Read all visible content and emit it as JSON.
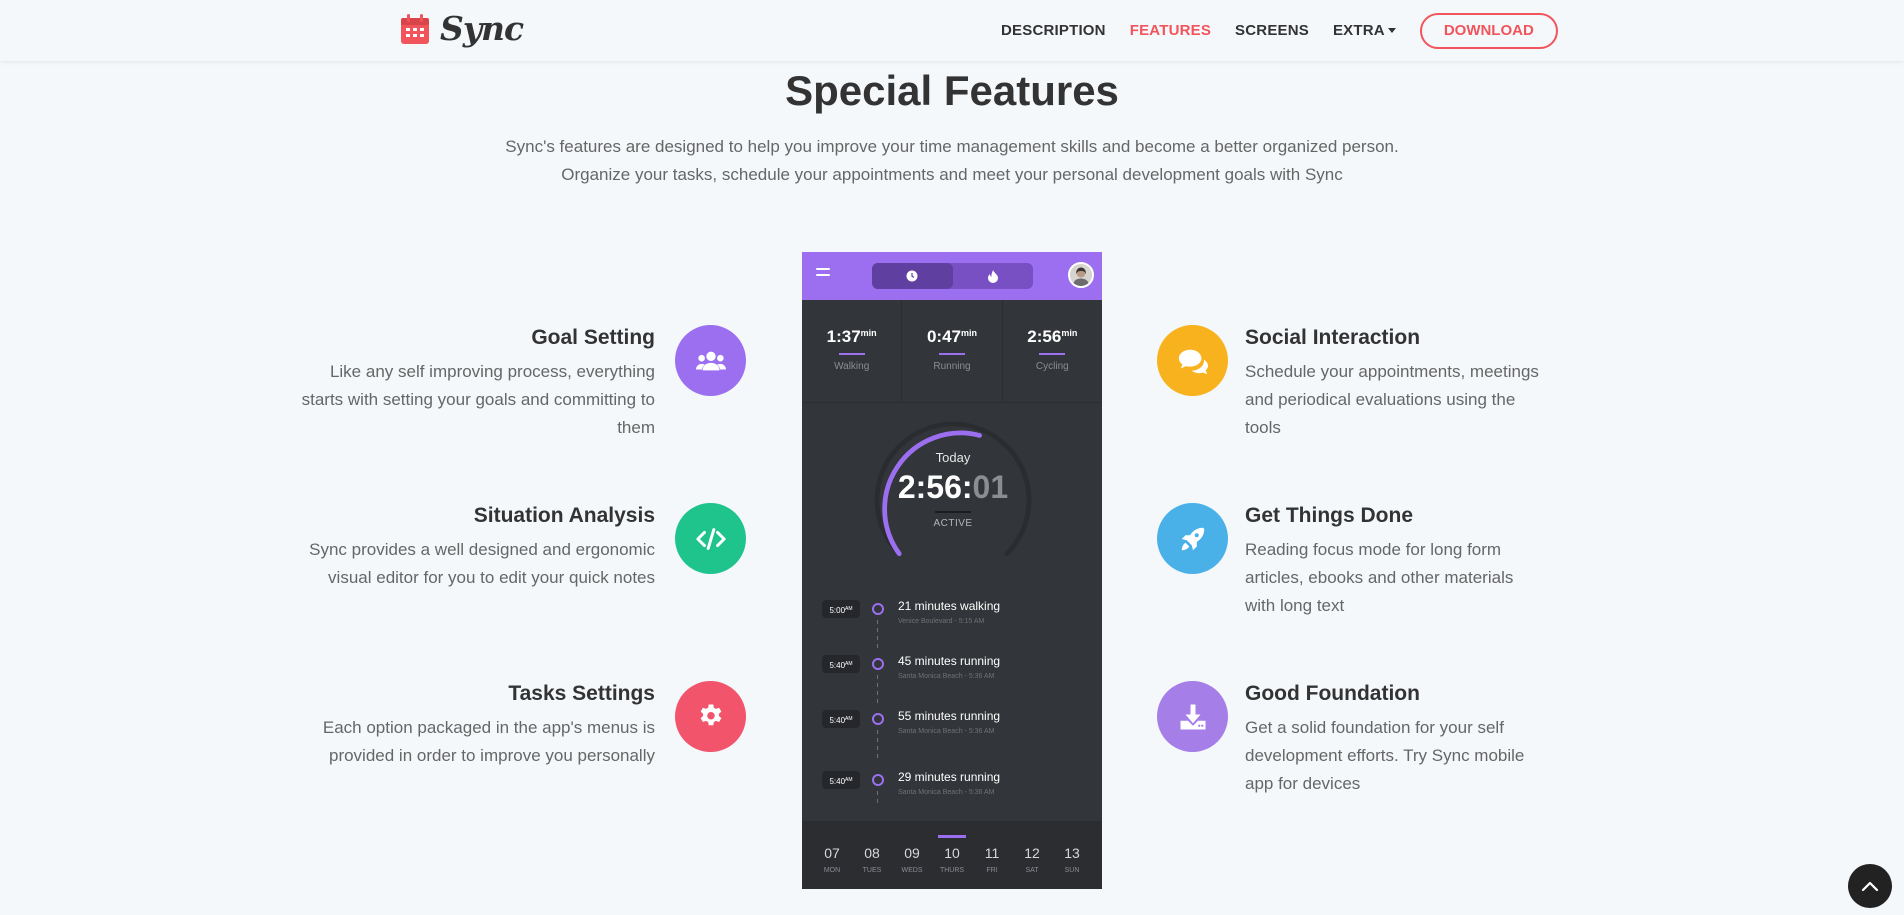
{
  "brand": {
    "name": "Sync",
    "icon": "calendar-icon",
    "color": "#f2545b"
  },
  "nav": {
    "items": [
      {
        "label": "DESCRIPTION",
        "active": false
      },
      {
        "label": "FEATURES",
        "active": true
      },
      {
        "label": "SCREENS",
        "active": false
      },
      {
        "label": "EXTRA",
        "active": false,
        "dropdown": true
      }
    ],
    "download_label": "DOWNLOAD"
  },
  "section": {
    "title": "Special Features",
    "lead_line1": "Sync's features are designed to help you improve your time management skills and become a better organized person.",
    "lead_line2": "Organize your tasks, schedule your appointments and meet your personal development goals with Sync"
  },
  "features_left": [
    {
      "title": "Goal Setting",
      "text": "Like any self improving process, everything starts with setting your goals and committing to them",
      "icon": "users-icon",
      "color": "#9c6ff0"
    },
    {
      "title": "Situation Analysis",
      "text": "Sync provides a well designed and ergonomic visual editor for you to edit your quick notes",
      "icon": "code-icon",
      "color": "#1fc48d"
    },
    {
      "title": "Tasks Settings",
      "text": "Each option packaged in the app's menus is provided in order to improve you personally",
      "icon": "gear-icon",
      "color": "#f2546b"
    }
  ],
  "features_right": [
    {
      "title": "Social Interaction",
      "text": "Schedule your appointments, meetings and periodical evaluations using the tools",
      "icon": "comments-icon",
      "color": "#f8b21d"
    },
    {
      "title": "Get Things Done",
      "text": "Reading focus mode for long form articles, ebooks and other materials with long text",
      "icon": "rocket-icon",
      "color": "#4ab0e8"
    },
    {
      "title": "Good Foundation",
      "text": "Get a solid foundation for your self development efforts. Try Sync mobile app for devices",
      "icon": "download-icon",
      "color": "#a57ee8"
    }
  ],
  "phone": {
    "stats": [
      {
        "value": "1:37",
        "unit": "min",
        "label": "Walking"
      },
      {
        "value": "0:47",
        "unit": "min",
        "label": "Running"
      },
      {
        "value": "2:56",
        "unit": "min",
        "label": "Cycling"
      }
    ],
    "ring": {
      "label": "Today",
      "time_main": "2:56:",
      "time_sec": "01",
      "status": "ACTIVE"
    },
    "timeline": [
      {
        "time": "5:00",
        "ampm": "AM",
        "title": "21 minutes walking",
        "sub": "Venice Boulevard - 5:15 AM"
      },
      {
        "time": "5:40",
        "ampm": "AM",
        "title": "45 minutes running",
        "sub": "Santa Monica Beach - 5:36 AM"
      },
      {
        "time": "5:40",
        "ampm": "AM",
        "title": "55 minutes running",
        "sub": "Santa Monica Beach - 5:36 AM"
      },
      {
        "time": "5:40",
        "ampm": "AM",
        "title": "29 minutes running",
        "sub": "Santa Monica Beach - 5:36 AM"
      }
    ],
    "days": [
      {
        "n": "07",
        "w": "MON"
      },
      {
        "n": "08",
        "w": "TUES"
      },
      {
        "n": "09",
        "w": "WEDS"
      },
      {
        "n": "10",
        "w": "THURS",
        "selected": true
      },
      {
        "n": "11",
        "w": "FRI"
      },
      {
        "n": "12",
        "w": "SAT"
      },
      {
        "n": "13",
        "w": "SUN"
      }
    ],
    "accent": "#9c6ff0"
  }
}
